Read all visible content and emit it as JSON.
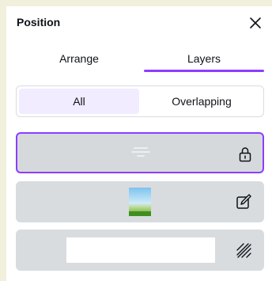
{
  "panel": {
    "title": "Position",
    "close_icon": "close-icon"
  },
  "tabs": {
    "items": [
      {
        "label": "Arrange",
        "active": false
      },
      {
        "label": "Layers",
        "active": true
      }
    ],
    "accent_color": "#8b3dff"
  },
  "filter": {
    "options": [
      {
        "label": "All",
        "selected": true
      },
      {
        "label": "Overlapping",
        "selected": false
      }
    ],
    "selected_bg": "#f1ecff"
  },
  "layers": [
    {
      "thumbnail": "text-element",
      "icon": "lock-icon",
      "selected": true
    },
    {
      "thumbnail": "landscape-image",
      "icon": "edit-icon",
      "selected": false
    },
    {
      "thumbnail": "white-background",
      "icon": "background-pattern-icon",
      "selected": false
    }
  ]
}
